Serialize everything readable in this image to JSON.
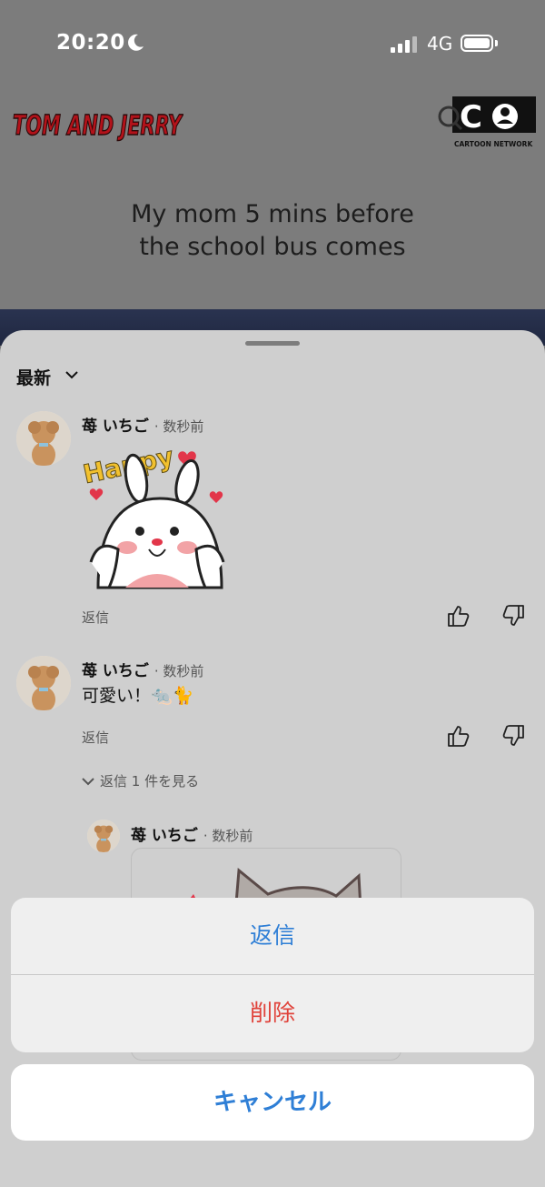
{
  "status_bar": {
    "time": "20:20",
    "network": "4G"
  },
  "video": {
    "show_logo_text": "TOM AND JERRY",
    "channel_logo_text": "CARTOON NETWORK",
    "caption_line1": "My mom 5 mins before",
    "caption_line2": "the school bus comes"
  },
  "comments_sheet": {
    "sort_label": "最新",
    "comments": [
      {
        "author": "苺 いちご",
        "time_ago": "· 数秒前",
        "sticker_text": "Happy",
        "reply_label": "返信"
      },
      {
        "author": "苺 いちご",
        "time_ago": "· 数秒前",
        "text": "可愛い！🐀🐈",
        "reply_label": "返信",
        "view_replies": "返信 1 件を見る"
      }
    ],
    "nested_reply": {
      "author": "苺 いちご",
      "time_ago": "· 数秒前"
    }
  },
  "action_sheet": {
    "reply": "返信",
    "delete": "削除",
    "cancel": "キャンセル"
  },
  "colors": {
    "action_blue": "#2f7fd6",
    "destructive_red": "#e0423a",
    "sheet_bg": "#cfcfcf"
  }
}
